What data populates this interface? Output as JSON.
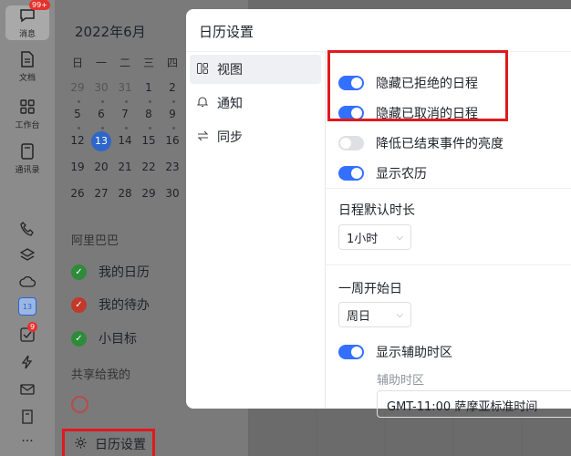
{
  "rail": {
    "messages_label": "消息",
    "messages_badge": "99+",
    "docs_label": "文档",
    "workspace_label": "工作台",
    "contacts_label": "通讯录",
    "calendar_icon_text": "13",
    "tasks_badge": "9",
    "more_label": "···"
  },
  "calendar": {
    "month_title": "2022年6月",
    "weekdays": [
      "日",
      "一",
      "二",
      "三",
      "四"
    ],
    "weeks": [
      [
        "29",
        "30",
        "31",
        "1",
        "2"
      ],
      [
        "5",
        "6",
        "7",
        "8",
        "9"
      ],
      [
        "12",
        "13",
        "14",
        "15",
        "16"
      ],
      [
        "19",
        "20",
        "21",
        "22",
        "23"
      ],
      [
        "26",
        "27",
        "28",
        "29",
        "30"
      ]
    ],
    "org_section": "阿里巴巴",
    "my_calendars": [
      {
        "label": "我的日历",
        "color": "#2e8b3a"
      },
      {
        "label": "我的待办",
        "color": "#c0392b"
      },
      {
        "label": "小目标",
        "color": "#2e8b3a"
      }
    ],
    "shared_section": "共享给我的",
    "settings_entry": "日历设置"
  },
  "dialog": {
    "title": "日历设置",
    "nav": [
      {
        "label": "视图",
        "icon": "grid-icon",
        "glyph": "▯▯"
      },
      {
        "label": "通知",
        "icon": "bell-icon",
        "glyph": "🔔︎"
      },
      {
        "label": "同步",
        "icon": "sync-icon",
        "glyph": "⇆"
      }
    ],
    "toggles": [
      {
        "label": "隐藏已拒绝的日程",
        "on": true
      },
      {
        "label": "隐藏已取消的日程",
        "on": true
      },
      {
        "label": "降低已结束事件的亮度",
        "on": false
      },
      {
        "label": "显示农历",
        "on": true
      }
    ],
    "default_duration_label": "日程默认时长",
    "default_duration_value": "1小时",
    "week_start_label": "一周开始日",
    "week_start_value": "周日",
    "aux_tz_toggle_label": "显示辅助时区",
    "aux_tz_label": "辅助时区",
    "aux_tz_value": "GMT-11:00 萨摩亚标准时间"
  },
  "colors": {
    "accent": "#3370ff",
    "highlight_box": "#e0191e"
  }
}
